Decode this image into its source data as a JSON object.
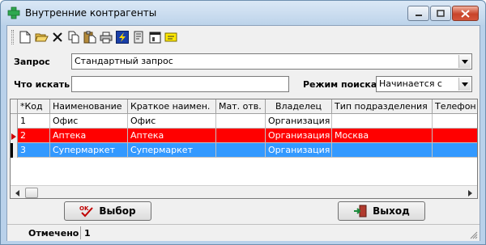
{
  "window": {
    "title": "Внутренние контрагенты"
  },
  "toolbar": {
    "buttons": [
      {
        "icon": "new-document-icon"
      },
      {
        "icon": "open-folder-icon"
      },
      {
        "icon": "delete-icon"
      },
      {
        "icon": "copy-icon"
      },
      {
        "icon": "paste-icon"
      },
      {
        "icon": "print-icon"
      },
      {
        "icon": "lightning-icon"
      },
      {
        "icon": "filter-icon"
      },
      {
        "icon": "dialog-icon"
      },
      {
        "icon": "note-icon"
      }
    ]
  },
  "query": {
    "label": "Запрос",
    "value": "Стандартный запрос"
  },
  "search": {
    "label": "Что искать",
    "value": "",
    "mode_label": "Режим поиска",
    "mode_value": "Начинается с"
  },
  "grid": {
    "columns": [
      "*Код",
      "Наименование",
      "Краткое наимен.",
      "Мат. отв.",
      "Владелец",
      "Тип подразделения",
      "Телефон"
    ],
    "rows": [
      {
        "code": "1",
        "name": "Офис",
        "short": "Офис",
        "mat": "",
        "owner": "Организация",
        "type": "",
        "phone": ""
      },
      {
        "code": "2",
        "name": "Аптека",
        "short": "Аптека",
        "mat": "",
        "owner": "Организация",
        "type": "Москва",
        "phone": ""
      },
      {
        "code": "3",
        "name": "Супермаркет",
        "short": "Супермаркет",
        "mat": "",
        "owner": "Организация",
        "type": "",
        "phone": ""
      }
    ],
    "row_colors": {
      "highlight": "#ff0000",
      "selected": "#3399ff"
    }
  },
  "buttons": {
    "select_label": "Выбор",
    "exit_label": "Выход"
  },
  "status": {
    "marked_label": "Отмечено",
    "marked_value": "1"
  }
}
